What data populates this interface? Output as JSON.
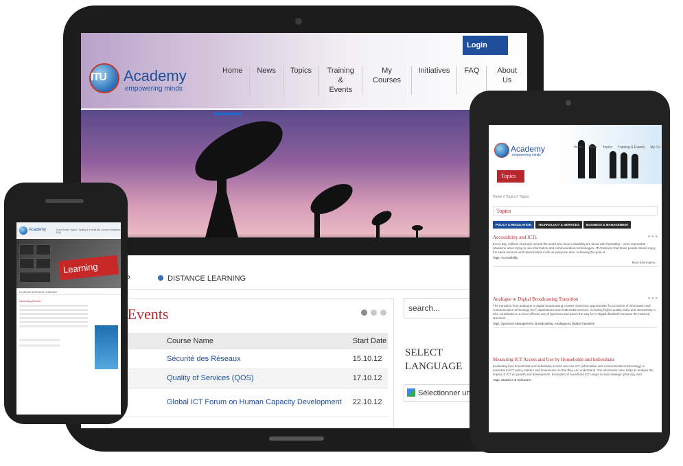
{
  "laptop": {
    "header": {
      "login_label": "Login",
      "logo_itu": "ITU",
      "logo_title": "Academy",
      "logo_tagline": "empowering minds",
      "nav": [
        "Home",
        "News",
        "Topics",
        "Training &\nEvents",
        "My Courses",
        "Initiatives",
        "FAQ",
        "About Us"
      ]
    },
    "tabs": {
      "partial_label": "OP",
      "distance_learning": "DISTANCE LEARNING"
    },
    "events": {
      "title": "g Events",
      "columns": [
        "Course Name",
        "Start Date"
      ],
      "rows": [
        {
          "course": "Sécurité des Réseaux",
          "date": "15.10.12"
        },
        {
          "course": "Quality of Services (QOS)",
          "date": "17.10.12"
        },
        {
          "course": "Global ICT Forum on Human Capacity Development",
          "date": "22.10.12"
        }
      ]
    },
    "sidebar": {
      "search_placeholder": "search...",
      "select_language": "SELECT LANGUAGE",
      "translate_label": "Sélectionner une"
    }
  },
  "tablet": {
    "logo_title": "Academy",
    "logo_tagline": "empowering minds",
    "nav": [
      "Home",
      "News",
      "Topics",
      "Training & Events",
      "My Co"
    ],
    "topics_tab": "Topics",
    "breadcrumb": "Home // Topics // Topics",
    "section_title": "Topics",
    "category_tabs": [
      "POLICY & REGULATION",
      "TECHNOLOGY & SERVICES",
      "BUSINESS & MANAGEMENT"
    ],
    "articles": [
      {
        "title": "Accessibility and ICTs",
        "body": "Every day, millions of people around the world who have a disability are faced with frustrating – even impossible – situations when trying to use information and communication technologies. ITU believes that these people should enjoy the same services and opportunities in life as everyone else. Achieving the goal of",
        "tags": "Tags: Accessibility",
        "more": "More information..."
      },
      {
        "title": "Analogue to Digital Broadcasting Transition",
        "body": "The transition from analogue to digital broadcasting creates numerous opportunities for provision of information and communication technology (ICT) applications and multimedia services, including higher quality video and interactivity. It also contributes to a more efficient use of spectrum and paves the way for a \"digital dividend\" because the reduced spectrum",
        "tags": "Tags: Spectrum Management, Broadcasting, Analogue to Digital Transition",
        "more": ""
      },
      {
        "title": "Measuring ICT Access and Use by Households and Individuals",
        "body": "Evaluating how households and individuals access and use ICT (information and communication technology) is essential to ICT policy makers and businesses so that they can understand. The information also helps to analyse the impact of ICT on growth and development. Examples of household ICT usage include strategic planning, and",
        "tags": "Tags: Statistics & Indicators",
        "more": ""
      }
    ]
  },
  "phone": {
    "logo_title": "Academy",
    "nav": "Home  News  Topics  Training & Events  My Courses  Initiatives  FAQ",
    "hero_word": "Learning",
    "bar_text": "LEARNING   DISTANCE LEARNING",
    "section_title": "Upcoming Events"
  }
}
